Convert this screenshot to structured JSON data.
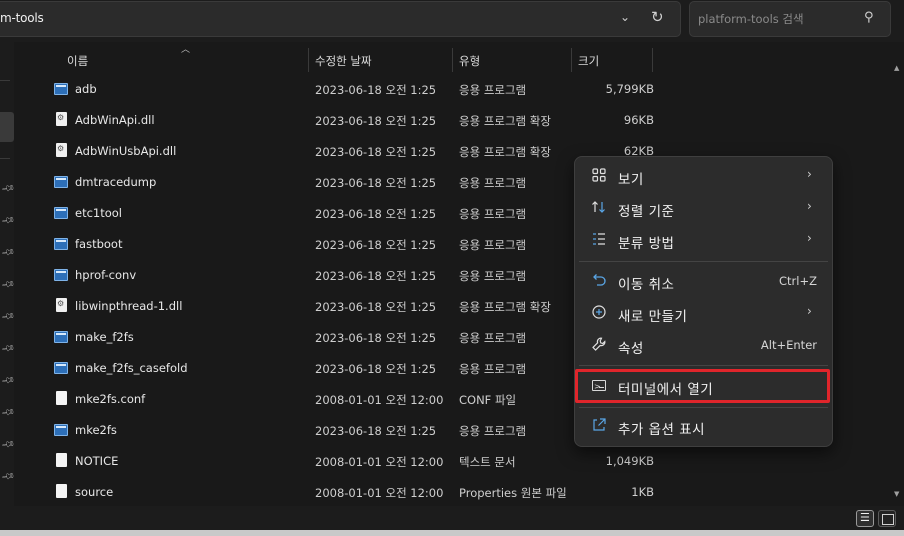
{
  "address_bar": {
    "path_text": "m-tools"
  },
  "search": {
    "placeholder": "platform-tools 검색"
  },
  "columns": {
    "name": "이름",
    "date": "수정한 날짜",
    "type": "유형",
    "size": "크기"
  },
  "files": [
    {
      "name": "adb",
      "date": "2023-06-18 오전 1:25",
      "type": "응용 프로그램",
      "size": "5,799KB",
      "icon": "exe"
    },
    {
      "name": "AdbWinApi.dll",
      "date": "2023-06-18 오전 1:25",
      "type": "응용 프로그램 확장",
      "size": "96KB",
      "icon": "dll"
    },
    {
      "name": "AdbWinUsbApi.dll",
      "date": "2023-06-18 오전 1:25",
      "type": "응용 프로그램 확장",
      "size": "62KB",
      "icon": "dll"
    },
    {
      "name": "dmtracedump",
      "date": "2023-06-18 오전 1:25",
      "type": "응용 프로그램",
      "size": "",
      "icon": "exe"
    },
    {
      "name": "etc1tool",
      "date": "2023-06-18 오전 1:25",
      "type": "응용 프로그램",
      "size": "",
      "icon": "exe"
    },
    {
      "name": "fastboot",
      "date": "2023-06-18 오전 1:25",
      "type": "응용 프로그램",
      "size": "",
      "icon": "exe"
    },
    {
      "name": "hprof-conv",
      "date": "2023-06-18 오전 1:25",
      "type": "응용 프로그램",
      "size": "",
      "icon": "exe"
    },
    {
      "name": "libwinpthread-1.dll",
      "date": "2023-06-18 오전 1:25",
      "type": "응용 프로그램 확장",
      "size": "",
      "icon": "dll"
    },
    {
      "name": "make_f2fs",
      "date": "2023-06-18 오전 1:25",
      "type": "응용 프로그램",
      "size": "",
      "icon": "exe"
    },
    {
      "name": "make_f2fs_casefold",
      "date": "2023-06-18 오전 1:25",
      "type": "응용 프로그램",
      "size": "",
      "icon": "exe"
    },
    {
      "name": "mke2fs.conf",
      "date": "2008-01-01 오전 12:00",
      "type": "CONF 파일",
      "size": "",
      "icon": "doc"
    },
    {
      "name": "mke2fs",
      "date": "2023-06-18 오전 1:25",
      "type": "응용 프로그램",
      "size": "",
      "icon": "exe"
    },
    {
      "name": "NOTICE",
      "date": "2008-01-01 오전 12:00",
      "type": "텍스트 문서",
      "size": "1,049KB",
      "icon": "doc"
    },
    {
      "name": "source",
      "date": "2008-01-01 오전 12:00",
      "type": "Properties 원본 파일",
      "size": "1KB",
      "icon": "doc"
    }
  ],
  "context_menu": {
    "view": {
      "label": "보기",
      "icon": "grid-icon"
    },
    "sort": {
      "label": "정렬 기준",
      "icon": "sort-icon"
    },
    "group": {
      "label": "분류 방법",
      "icon": "group-icon"
    },
    "undo": {
      "label": "이동 취소",
      "shortcut": "Ctrl+Z",
      "icon": "undo-icon"
    },
    "new": {
      "label": "새로 만들기",
      "icon": "plus-circle-icon"
    },
    "properties": {
      "label": "속성",
      "shortcut": "Alt+Enter",
      "icon": "wrench-icon"
    },
    "open_terminal": {
      "label": "터미널에서 열기",
      "icon": "terminal-icon",
      "highlight_color": "#e0252b"
    },
    "more_options": {
      "label": "추가 옵션 표시",
      "icon": "share-icon"
    }
  },
  "colors": {
    "accent": "#5aa6e6",
    "highlight": "#e0252b"
  }
}
